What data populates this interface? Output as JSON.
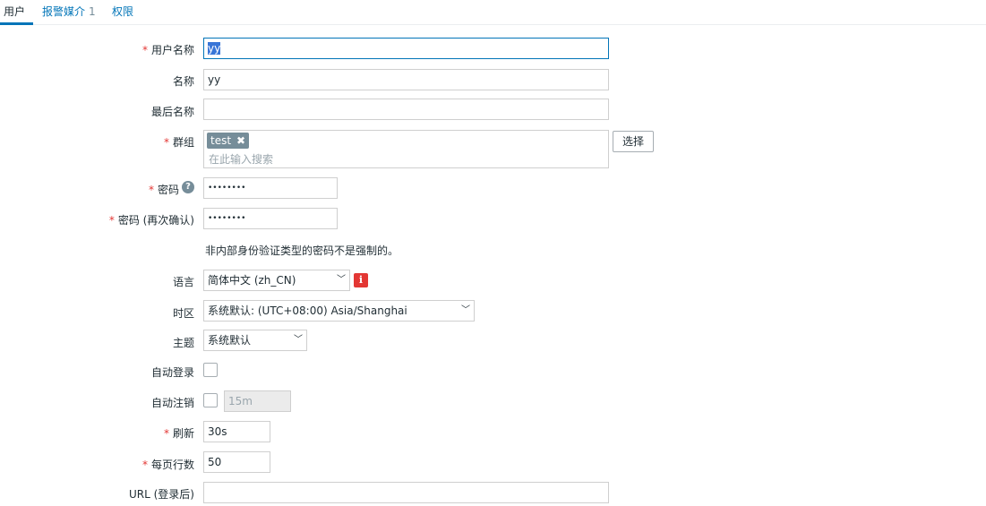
{
  "tabs": [
    {
      "label": "用户"
    },
    {
      "label": "报警媒介",
      "count": "1"
    },
    {
      "label": "权限"
    }
  ],
  "form": {
    "alias": {
      "label": "用户名称",
      "value": "yy"
    },
    "name": {
      "label": "名称",
      "value": "yy"
    },
    "surname": {
      "label": "最后名称",
      "value": ""
    },
    "groups": {
      "label": "群组",
      "chip": "test",
      "placeholder": "在此输入搜索",
      "select_button": "选择"
    },
    "password": {
      "label": "密码",
      "help": "?",
      "value": "••••••••"
    },
    "password_confirm": {
      "label": "密码 (再次确认)",
      "value": "••••••••"
    },
    "password_note": "非内部身份验证类型的密码不是强制的。",
    "language": {
      "label": "语言",
      "value": "简体中文 (zh_CN)",
      "info": "i"
    },
    "timezone": {
      "label": "时区",
      "value": "系统默认: (UTC+08:00) Asia/Shanghai"
    },
    "theme": {
      "label": "主题",
      "value": "系统默认"
    },
    "autologin": {
      "label": "自动登录"
    },
    "autologout": {
      "label": "自动注销",
      "value": "15m"
    },
    "refresh": {
      "label": "刷新",
      "value": "30s"
    },
    "rows_per_page": {
      "label": "每页行数",
      "value": "50"
    },
    "url": {
      "label": "URL (登录后)",
      "value": ""
    }
  },
  "required_mark": "*",
  "chevron": "﹀",
  "chip_remove": "✖"
}
